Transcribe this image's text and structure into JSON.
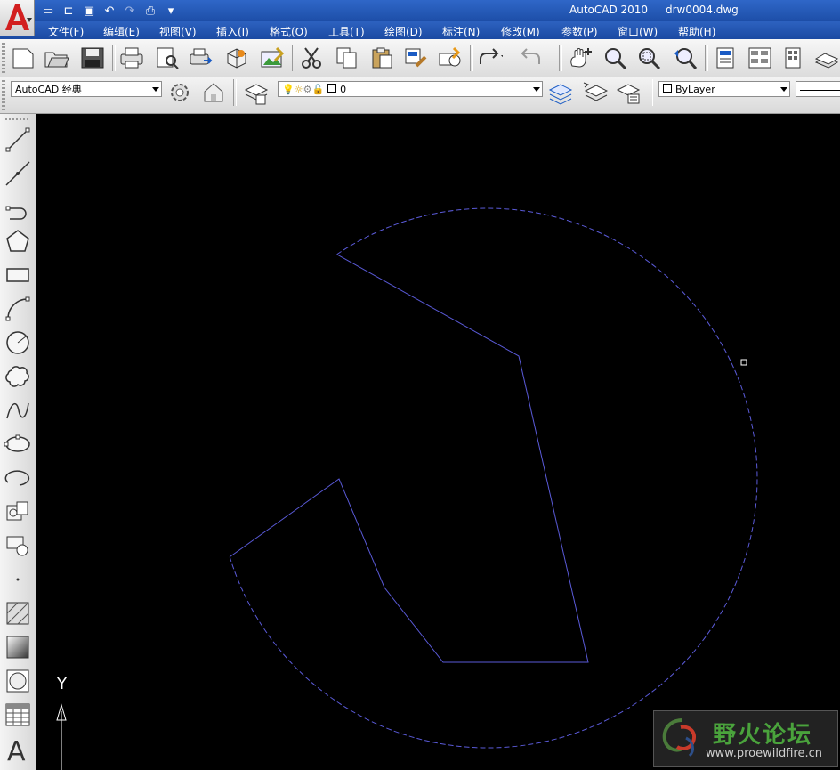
{
  "app": {
    "name": "AutoCAD 2010",
    "document": "drw0004.dwg"
  },
  "menu": [
    "文件(F)",
    "编辑(E)",
    "视图(V)",
    "插入(I)",
    "格式(O)",
    "工具(T)",
    "绘图(D)",
    "标注(N)",
    "修改(M)",
    "参数(P)",
    "窗口(W)",
    "帮助(H)"
  ],
  "workspace": {
    "value": "AutoCAD 经典"
  },
  "layer": {
    "value": "0"
  },
  "color": {
    "value": "ByLayer"
  },
  "ucs": {
    "y_label": "Y"
  },
  "watermark": {
    "title": "野火论坛",
    "url": "www.proewildfire.cn"
  },
  "colors": {
    "drawing_line": "#5a5ad8",
    "canvas": "#000000",
    "title_bar": "#2f67c8"
  }
}
